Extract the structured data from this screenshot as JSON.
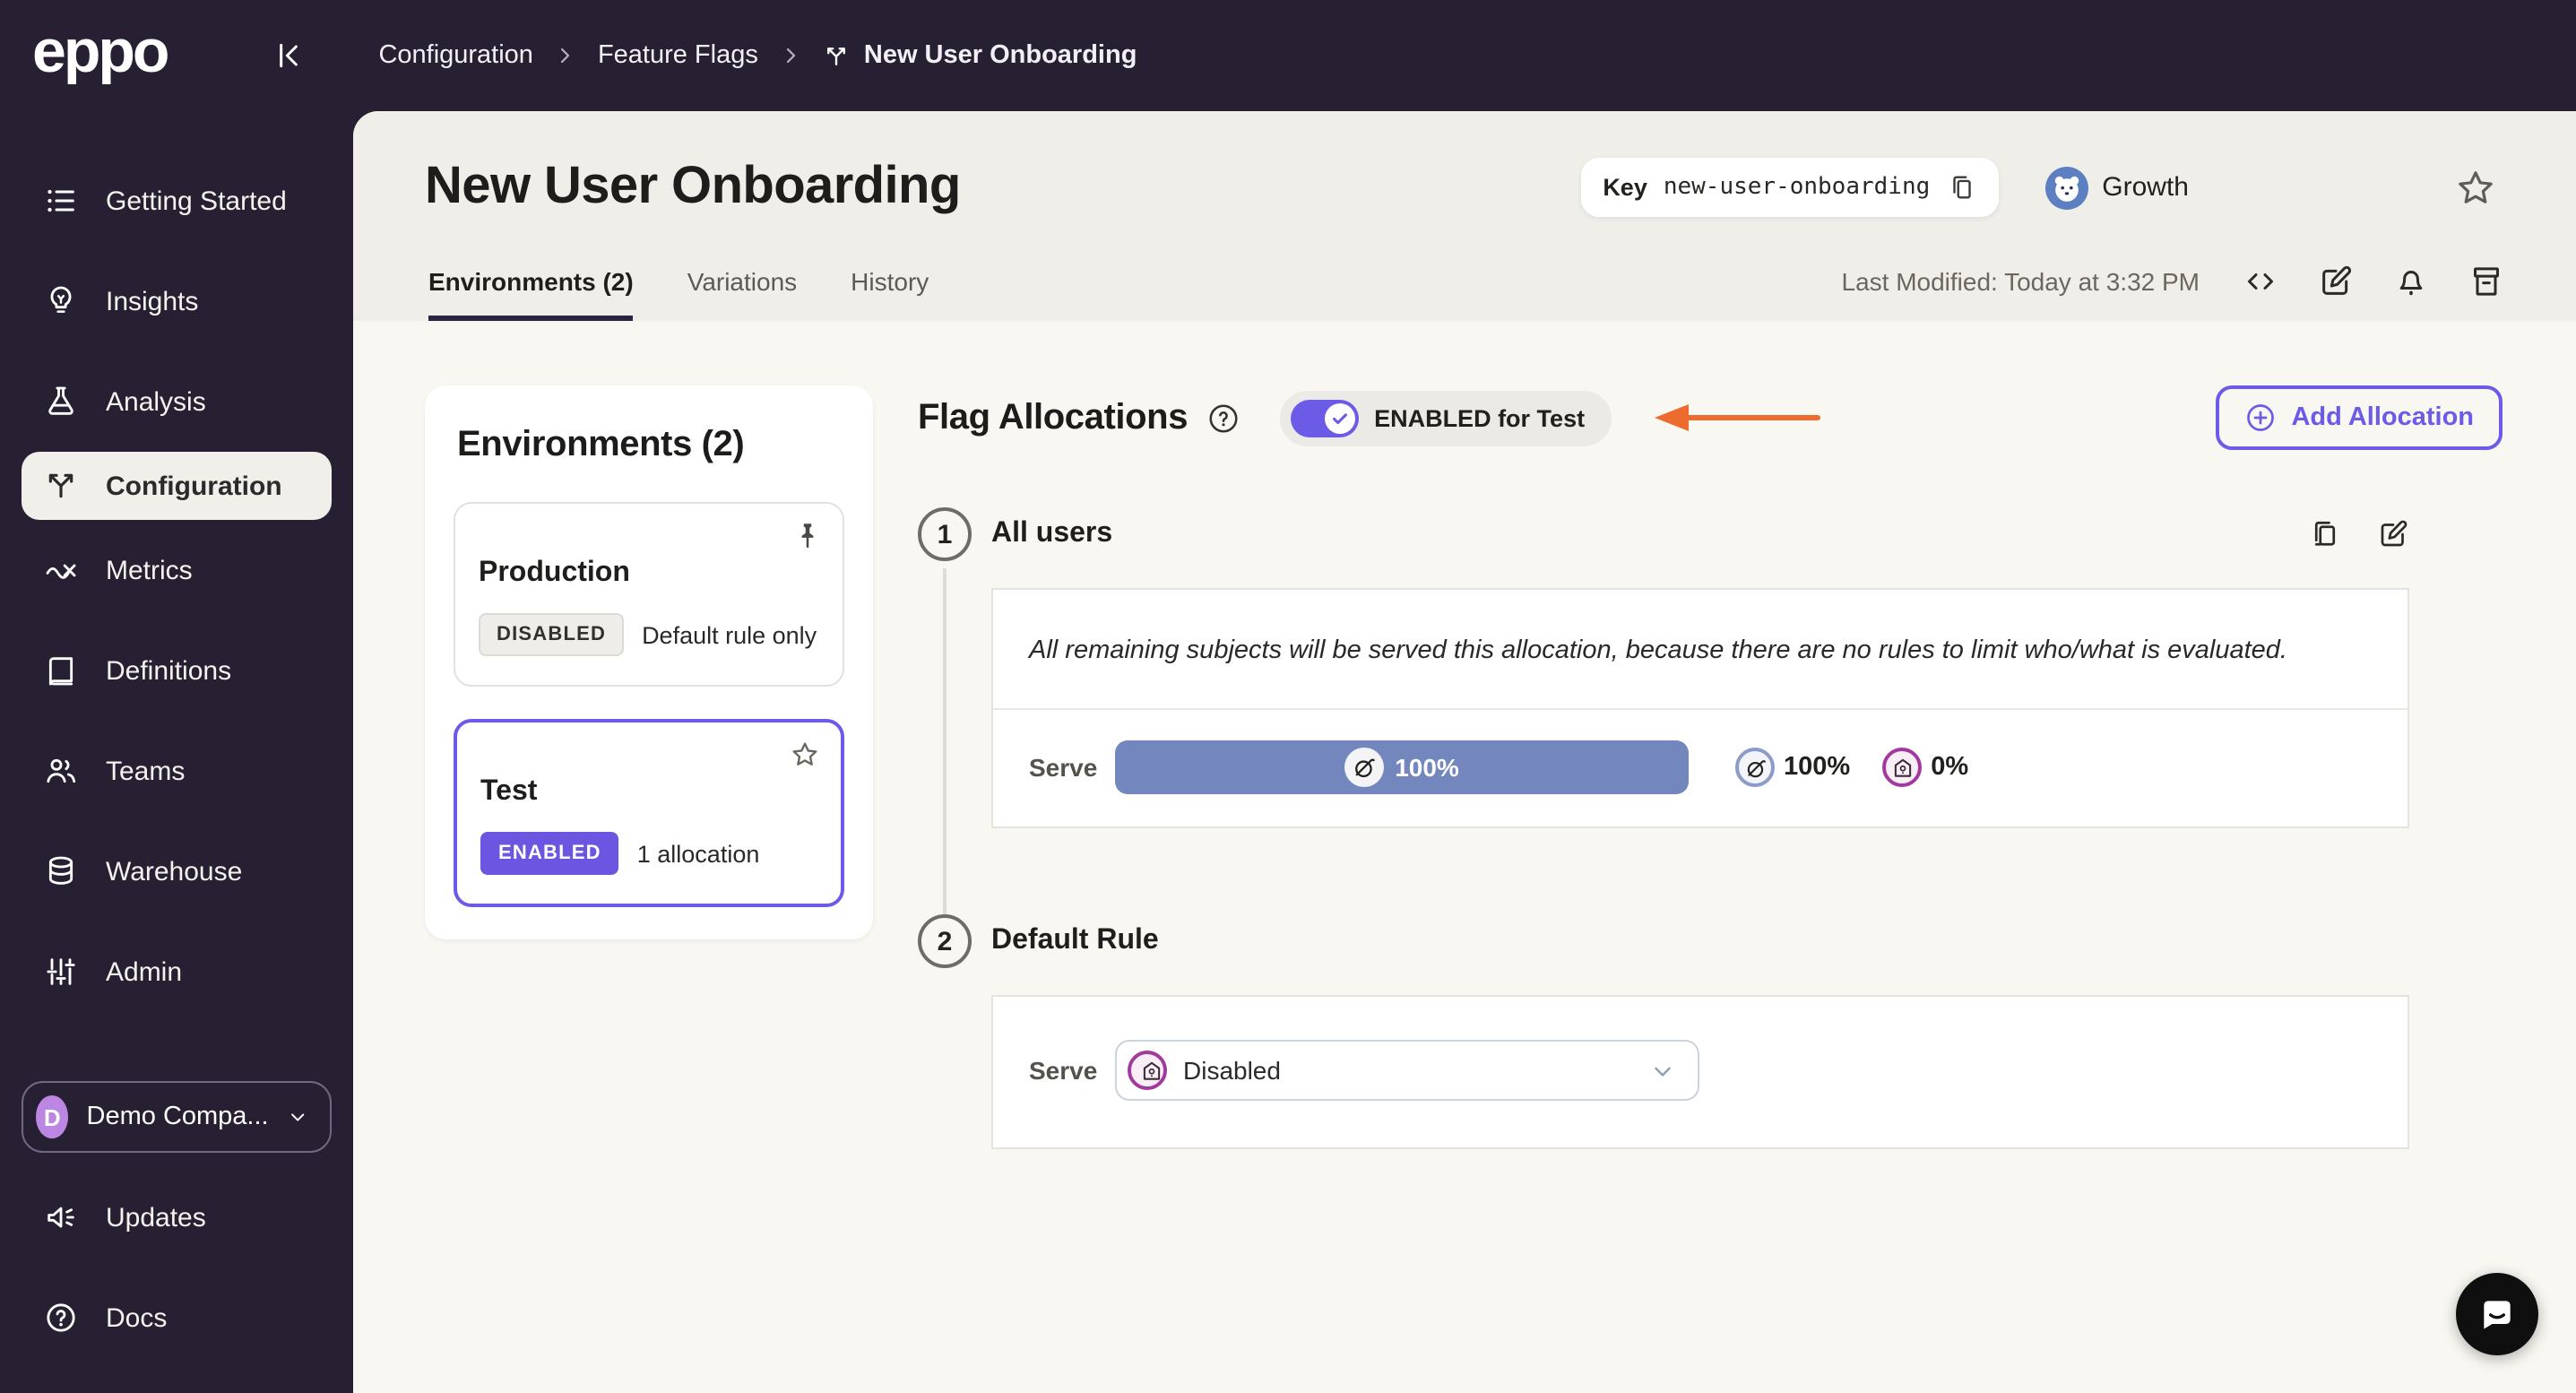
{
  "topbar": {
    "logo": "eppo",
    "breadcrumb": {
      "item0": "Configuration",
      "item1": "Feature Flags",
      "item2": "New User Onboarding"
    }
  },
  "sidebar": {
    "items": [
      {
        "label": "Getting Started",
        "icon": "list-icon",
        "active": false
      },
      {
        "label": "Insights",
        "icon": "lightbulb-icon",
        "active": false
      },
      {
        "label": "Analysis",
        "icon": "flask-icon",
        "active": false
      },
      {
        "label": "Configuration",
        "icon": "branch-icon",
        "active": true
      },
      {
        "label": "Metrics",
        "icon": "metrics-icon",
        "active": false
      },
      {
        "label": "Definitions",
        "icon": "book-icon",
        "active": false
      },
      {
        "label": "Teams",
        "icon": "people-icon",
        "active": false
      },
      {
        "label": "Warehouse",
        "icon": "database-icon",
        "active": false
      },
      {
        "label": "Admin",
        "icon": "sliders-icon",
        "active": false
      }
    ],
    "workspace": {
      "initial": "D",
      "name": "Demo Compa..."
    },
    "footer": {
      "updates": "Updates",
      "docs": "Docs"
    }
  },
  "header": {
    "title": "New User Onboarding",
    "key": {
      "label": "Key",
      "value": "new-user-onboarding"
    },
    "team": {
      "name": "Growth"
    },
    "tabs": [
      {
        "label": "Environments (2)",
        "active": true
      },
      {
        "label": "Variations",
        "active": false
      },
      {
        "label": "History",
        "active": false
      }
    ],
    "last_modified": "Last Modified: Today at 3:32 PM"
  },
  "environments_panel": {
    "title": "Environments (2)",
    "cards": [
      {
        "name": "Production",
        "status": "DISABLED",
        "note": "Default rule only",
        "pinned": true,
        "selected": false
      },
      {
        "name": "Test",
        "status": "ENABLED",
        "note": "1 allocation",
        "starred": false,
        "selected": true
      }
    ]
  },
  "flag_allocations": {
    "title": "Flag Allocations",
    "toggle": {
      "on": true,
      "label": "ENABLED for Test"
    },
    "add_button": "Add Allocation",
    "allocations": [
      {
        "number": "1",
        "title": "All users",
        "description": "All remaining subjects will be served this allocation, because there are no rules to limit who/what is evaluated.",
        "serve_label": "Serve",
        "bar": {
          "value": "100%",
          "variation_icon": "acorn-variation-icon"
        },
        "legend": [
          {
            "icon": "acorn-variation-icon",
            "value": "100%"
          },
          {
            "icon": "house-variation-icon",
            "value": "0%"
          }
        ]
      },
      {
        "number": "2",
        "title": "Default Rule",
        "serve_label": "Serve",
        "dropdown": {
          "value": "Disabled",
          "icon": "house-variation-icon"
        }
      }
    ]
  },
  "colors": {
    "accent_purple": "#6C5BE7",
    "enabled_badge": "#6C55E0",
    "serve_bar_blue": "#7386BD",
    "annotation_arrow_orange": "#EC6B2D",
    "sidebar_dark": "#272033",
    "header_band": "#EFEEE9",
    "content_bg": "#F8F7F2",
    "workspace_avatar": "#BC87E2",
    "team_avatar_blue": "#5C7FC1"
  }
}
